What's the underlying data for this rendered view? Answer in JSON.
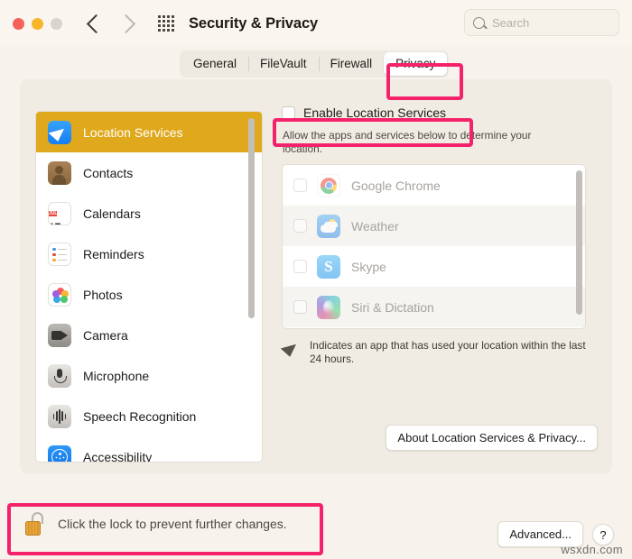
{
  "window": {
    "title": "Security & Privacy",
    "traffic_lights": [
      "close",
      "minimize",
      "zoom"
    ],
    "nav": {
      "back": "back-chevron",
      "forward": "forward-chevron"
    },
    "grid_icon": "show-all-icon"
  },
  "search": {
    "placeholder": "Search",
    "icon": "search-icon"
  },
  "tabs": [
    {
      "label": "General",
      "active": false
    },
    {
      "label": "FileVault",
      "active": false
    },
    {
      "label": "Firewall",
      "active": false
    },
    {
      "label": "Privacy",
      "active": true
    }
  ],
  "sidebar": {
    "items": [
      {
        "label": "Location Services",
        "icon": "location-services-icon",
        "selected": true
      },
      {
        "label": "Contacts",
        "icon": "contacts-icon",
        "selected": false
      },
      {
        "label": "Calendars",
        "icon": "calendar-icon",
        "selected": false
      },
      {
        "label": "Reminders",
        "icon": "reminders-icon",
        "selected": false
      },
      {
        "label": "Photos",
        "icon": "photos-icon",
        "selected": false
      },
      {
        "label": "Camera",
        "icon": "camera-icon",
        "selected": false
      },
      {
        "label": "Microphone",
        "icon": "microphone-icon",
        "selected": false
      },
      {
        "label": "Speech Recognition",
        "icon": "speech-recognition-icon",
        "selected": false
      },
      {
        "label": "Accessibility",
        "icon": "accessibility-icon",
        "selected": false
      }
    ],
    "calendar_icon": {
      "month": "JUL",
      "day": "17"
    }
  },
  "content": {
    "enable_checkbox_label": "Enable Location Services",
    "enable_checked": false,
    "description": "Allow the apps and services below to determine your location.",
    "apps": [
      {
        "label": "Google Chrome",
        "icon": "chrome-icon",
        "checked": false
      },
      {
        "label": "Weather",
        "icon": "weather-icon",
        "checked": false
      },
      {
        "label": "Skype",
        "icon": "skype-icon",
        "checked": false
      },
      {
        "label": "Siri & Dictation",
        "icon": "siri-icon",
        "checked": false
      }
    ],
    "note": "Indicates an app that has used your location within the last 24 hours.",
    "note_icon": "location-arrow-icon",
    "about_button": "About Location Services & Privacy..."
  },
  "footer": {
    "lock_icon": "unlocked-padlock-icon",
    "lock_text": "Click the lock to prevent further changes.",
    "advanced_button": "Advanced...",
    "help_button": "?"
  },
  "watermark": "wsxdn.com",
  "colors": {
    "accent_selected": "#e0a81c",
    "annotation": "#f4226b",
    "window_bg": "#f7f3ec",
    "panel_bg": "#f1ece3"
  }
}
